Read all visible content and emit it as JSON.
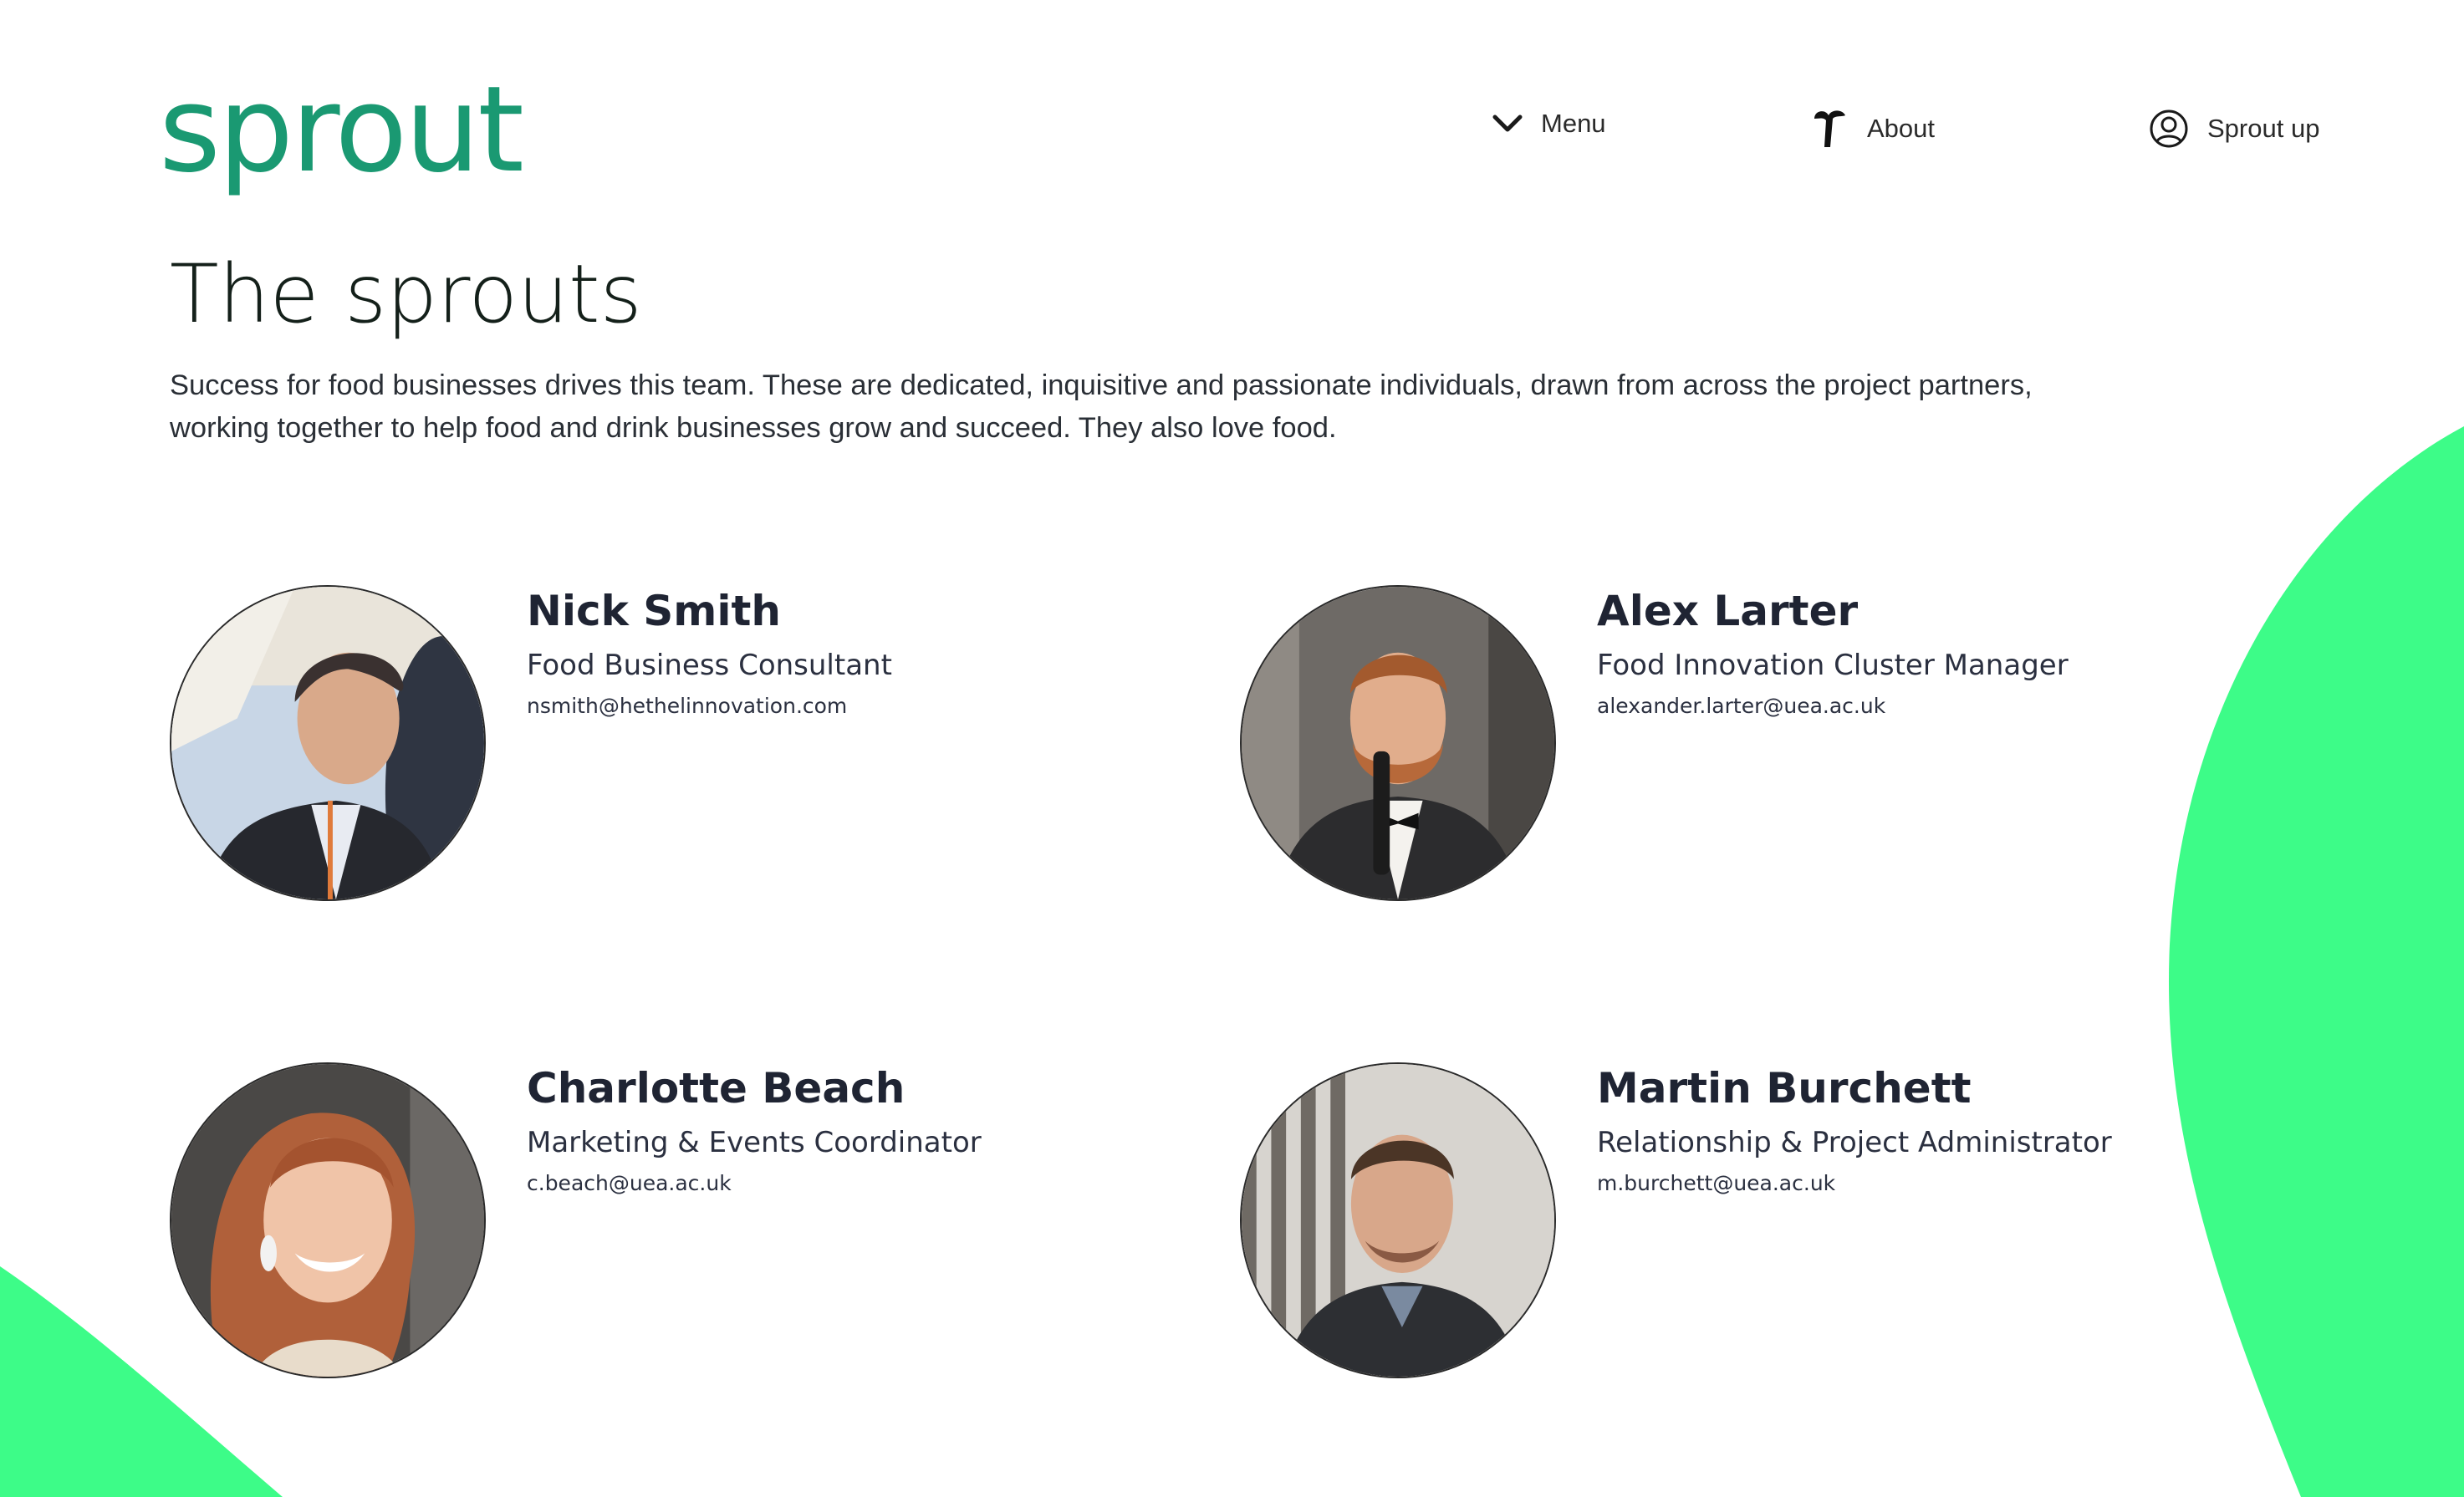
{
  "brand": {
    "logo_text": "sprout",
    "logo_color": "#1a9972"
  },
  "nav": {
    "menu": {
      "label": "Menu",
      "icon": "chevron-down-icon"
    },
    "about": {
      "label": "About",
      "icon": "sprout-icon"
    },
    "account": {
      "label": "Sprout up",
      "icon": "user-circle-icon"
    }
  },
  "intro": {
    "title": "The sprouts",
    "text": "Success for food businesses drives this team. These are dedicated, inquisitive and passionate individuals, drawn from across the project partners, working together to help food and drink businesses grow and succeed. They also love food."
  },
  "team": [
    {
      "name": "Nick Smith",
      "role": "Food Business Consultant",
      "email": "nsmith@hethelinnovation.com"
    },
    {
      "name": "Alex Larter",
      "role": "Food Innovation Cluster Manager",
      "email": "alexander.larter@uea.ac.uk"
    },
    {
      "name": "Charlotte Beach",
      "role": "Marketing & Events Coordinator",
      "email": "c.beach@uea.ac.uk"
    },
    {
      "name": "Martin Burchett",
      "role": "Relationship & Project Administrator",
      "email": "m.burchett@uea.ac.uk"
    }
  ],
  "colors": {
    "accent_green": "#3dfc88",
    "brand_green": "#1a9972",
    "text_dark": "#1f2433"
  }
}
